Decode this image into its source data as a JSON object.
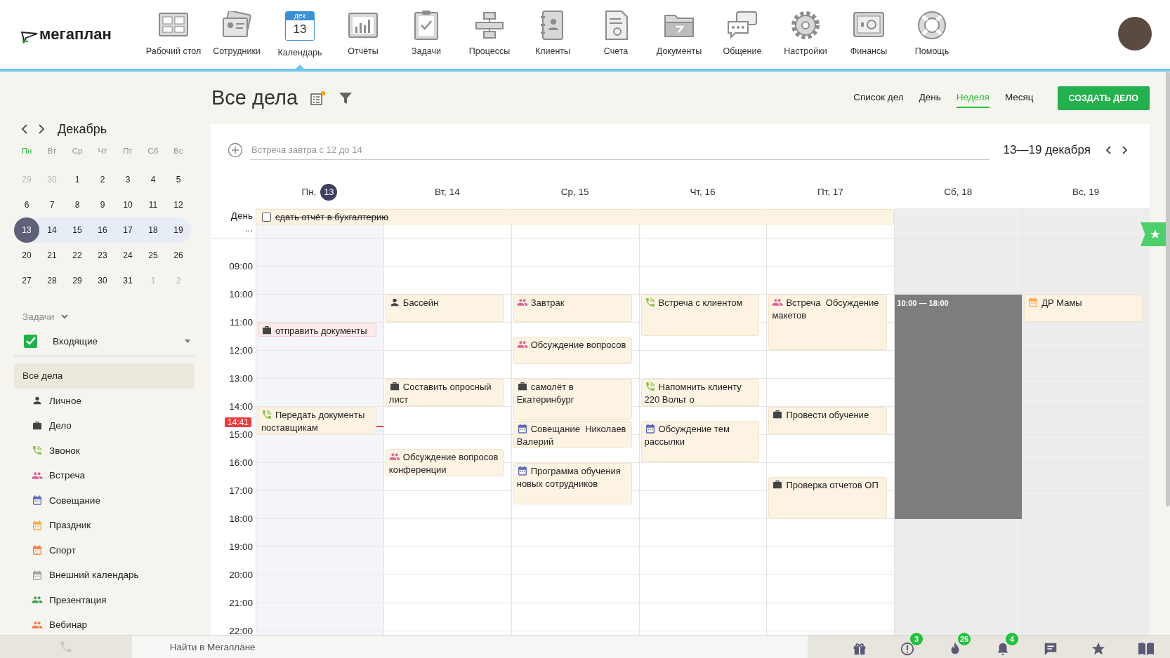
{
  "logo": {
    "text": "мегаплан"
  },
  "nav": [
    {
      "label": "Рабочий стол",
      "selected": false
    },
    {
      "label": "Сотрудники",
      "selected": false
    },
    {
      "label": "Календарь",
      "selected": true,
      "month": "дек",
      "day": "13"
    },
    {
      "label": "Отчёты",
      "selected": false
    },
    {
      "label": "Задачи",
      "selected": false
    },
    {
      "label": "Процессы",
      "selected": false
    },
    {
      "label": "Клиенты",
      "selected": false
    },
    {
      "label": "Счета",
      "selected": false
    },
    {
      "label": "Документы",
      "selected": false
    },
    {
      "label": "Общение",
      "selected": false
    },
    {
      "label": "Настройки",
      "selected": false
    },
    {
      "label": "Финансы",
      "selected": false
    },
    {
      "label": "Помощь",
      "selected": false
    }
  ],
  "mini_calendar": {
    "month": "Декабрь",
    "weekdays": [
      {
        "label": "Пн",
        "selected": true
      },
      {
        "label": "Вт",
        "selected": false
      },
      {
        "label": "Ср",
        "selected": false
      },
      {
        "label": "Чт",
        "selected": false
      },
      {
        "label": "Пт",
        "selected": false
      },
      {
        "label": "Сб",
        "selected": false
      },
      {
        "label": "Вс",
        "selected": false
      }
    ],
    "weeks": [
      {
        "selected": false,
        "days": [
          {
            "label": "29",
            "kind": "other"
          },
          {
            "label": "30",
            "kind": "other"
          },
          {
            "label": "1",
            "kind": "normal"
          },
          {
            "label": "2",
            "kind": "normal"
          },
          {
            "label": "3",
            "kind": "normal"
          },
          {
            "label": "4",
            "kind": "normal"
          },
          {
            "label": "5",
            "kind": "normal"
          }
        ]
      },
      {
        "selected": false,
        "days": [
          {
            "label": "6",
            "kind": "normal"
          },
          {
            "label": "7",
            "kind": "normal"
          },
          {
            "label": "8",
            "kind": "normal"
          },
          {
            "label": "9",
            "kind": "normal"
          },
          {
            "label": "10",
            "kind": "normal"
          },
          {
            "label": "11",
            "kind": "normal"
          },
          {
            "label": "12",
            "kind": "normal"
          }
        ]
      },
      {
        "selected": true,
        "days": [
          {
            "label": "13",
            "kind": "today"
          },
          {
            "label": "14",
            "kind": "normal"
          },
          {
            "label": "15",
            "kind": "normal"
          },
          {
            "label": "16",
            "kind": "normal"
          },
          {
            "label": "17",
            "kind": "normal"
          },
          {
            "label": "18",
            "kind": "normal"
          },
          {
            "label": "19",
            "kind": "normal"
          }
        ]
      },
      {
        "selected": false,
        "days": [
          {
            "label": "20",
            "kind": "normal"
          },
          {
            "label": "21",
            "kind": "normal"
          },
          {
            "label": "22",
            "kind": "normal"
          },
          {
            "label": "23",
            "kind": "normal"
          },
          {
            "label": "24",
            "kind": "normal"
          },
          {
            "label": "25",
            "kind": "normal"
          },
          {
            "label": "26",
            "kind": "normal"
          }
        ]
      },
      {
        "selected": false,
        "days": [
          {
            "label": "27",
            "kind": "normal"
          },
          {
            "label": "28",
            "kind": "normal"
          },
          {
            "label": "29",
            "kind": "normal"
          },
          {
            "label": "30",
            "kind": "normal"
          },
          {
            "label": "31",
            "kind": "normal"
          },
          {
            "label": "1",
            "kind": "other"
          },
          {
            "label": "2",
            "kind": "other"
          }
        ]
      }
    ]
  },
  "tasks_section": {
    "label": "Задачи",
    "filter": {
      "label": "Входящие",
      "checked": true
    }
  },
  "categories": [
    {
      "label": "Все дела",
      "kind": "all",
      "selected": true
    },
    {
      "label": "Личное",
      "kind": "personal",
      "selected": false
    },
    {
      "label": "Дело",
      "kind": "task",
      "selected": false
    },
    {
      "label": "Звонок",
      "kind": "call",
      "selected": false
    },
    {
      "label": "Встреча",
      "kind": "meeting",
      "selected": false
    },
    {
      "label": "Совещание",
      "kind": "conference",
      "selected": false
    },
    {
      "label": "Праздник",
      "kind": "holiday",
      "selected": false
    },
    {
      "label": "Спорт",
      "kind": "sport",
      "selected": false
    },
    {
      "label": "Внешний календарь",
      "kind": "external",
      "selected": false
    },
    {
      "label": "Презентация",
      "kind": "presentation",
      "selected": false
    },
    {
      "label": "Вебинар",
      "kind": "webinar",
      "selected": false
    }
  ],
  "page": {
    "title": "Все дела",
    "views": [
      {
        "label": "Список дел",
        "selected": false
      },
      {
        "label": "День",
        "selected": false
      },
      {
        "label": "Неделя",
        "selected": true
      },
      {
        "label": "Месяц",
        "selected": false
      }
    ],
    "create_button": "СОЗДАТЬ ДЕЛО"
  },
  "quick_add": {
    "placeholder": "Встреча завтра с 12 до 14"
  },
  "range": {
    "label": "13—19 декабря"
  },
  "all_day": {
    "label": "День",
    "more": "..."
  },
  "hours": [
    "09:00",
    "10:00",
    "11:00",
    "12:00",
    "13:00",
    "14:00",
    "15:00",
    "16:00",
    "17:00",
    "18:00",
    "19:00",
    "20:00",
    "21:00",
    "22:00"
  ],
  "now": {
    "label": "14:41"
  },
  "days": [
    {
      "weekday": "Пн,",
      "date": "13",
      "today": true,
      "weekend": false,
      "all_day": [
        {
          "title": "сдать отчёт в бухгалтерию",
          "checked": false,
          "crossed_out": true
        }
      ],
      "events": [
        {
          "kind": "task",
          "title": "отправить документы",
          "overdue": true
        },
        {
          "kind": "call",
          "title": "Передать документы поставщикам",
          "overdue": false
        }
      ]
    },
    {
      "weekday": "Вт,",
      "date": "14",
      "today": false,
      "weekend": false,
      "events": [
        {
          "kind": "personal",
          "title": "Бассейн",
          "overdue": false
        },
        {
          "kind": "task",
          "title": "Составить опросный лист",
          "overdue": false
        },
        {
          "kind": "meeting",
          "title": "Обсуждение вопросов конференции",
          "overdue": false
        }
      ]
    },
    {
      "weekday": "Ср,",
      "date": "15",
      "today": false,
      "weekend": false,
      "events": [
        {
          "kind": "meeting",
          "title": "Завтрак",
          "overdue": false
        },
        {
          "kind": "meeting",
          "title": "Обсуждение вопросов",
          "overdue": false
        },
        {
          "kind": "task",
          "title": "самолёт в Екатеринбург",
          "overdue": false
        },
        {
          "kind": "conference",
          "title": "Совещание  Николаев Валерий",
          "overdue": false
        },
        {
          "kind": "conference",
          "title": "Программа обучения новых сотрудников",
          "overdue": false
        }
      ]
    },
    {
      "weekday": "Чт,",
      "date": "16",
      "today": false,
      "weekend": false,
      "events": [
        {
          "kind": "call",
          "title": "Встреча с клиентом",
          "overdue": false
        },
        {
          "kind": "call",
          "title": "Напомнить клиенту 220 Вольт о",
          "overdue": false
        },
        {
          "kind": "conference",
          "title": "Обсуждение тем рассылки",
          "overdue": false
        }
      ]
    },
    {
      "weekday": "Пт,",
      "date": "17",
      "today": false,
      "weekend": false,
      "events": [
        {
          "kind": "meeting",
          "title": "Встреча  Обсуждение макетов",
          "overdue": false
        },
        {
          "kind": "task",
          "title": "Провести обучение",
          "overdue": false
        },
        {
          "kind": "task",
          "title": "Проверка отчетов ОП",
          "overdue": false
        }
      ]
    },
    {
      "weekday": "Сб,",
      "date": "18",
      "today": false,
      "weekend": true,
      "events": [
        {
          "kind": "busy",
          "title": "10:00 — 18:00"
        }
      ]
    },
    {
      "weekday": "Вс,",
      "date": "19",
      "today": false,
      "weekend": true,
      "events": [
        {
          "kind": "holiday",
          "title": "ДР Мамы",
          "overdue": false
        }
      ]
    }
  ],
  "search": {
    "placeholder": "Найти в Мегаплане"
  },
  "badges": {
    "alerts": "3",
    "hot": "25",
    "notifications": "4"
  }
}
